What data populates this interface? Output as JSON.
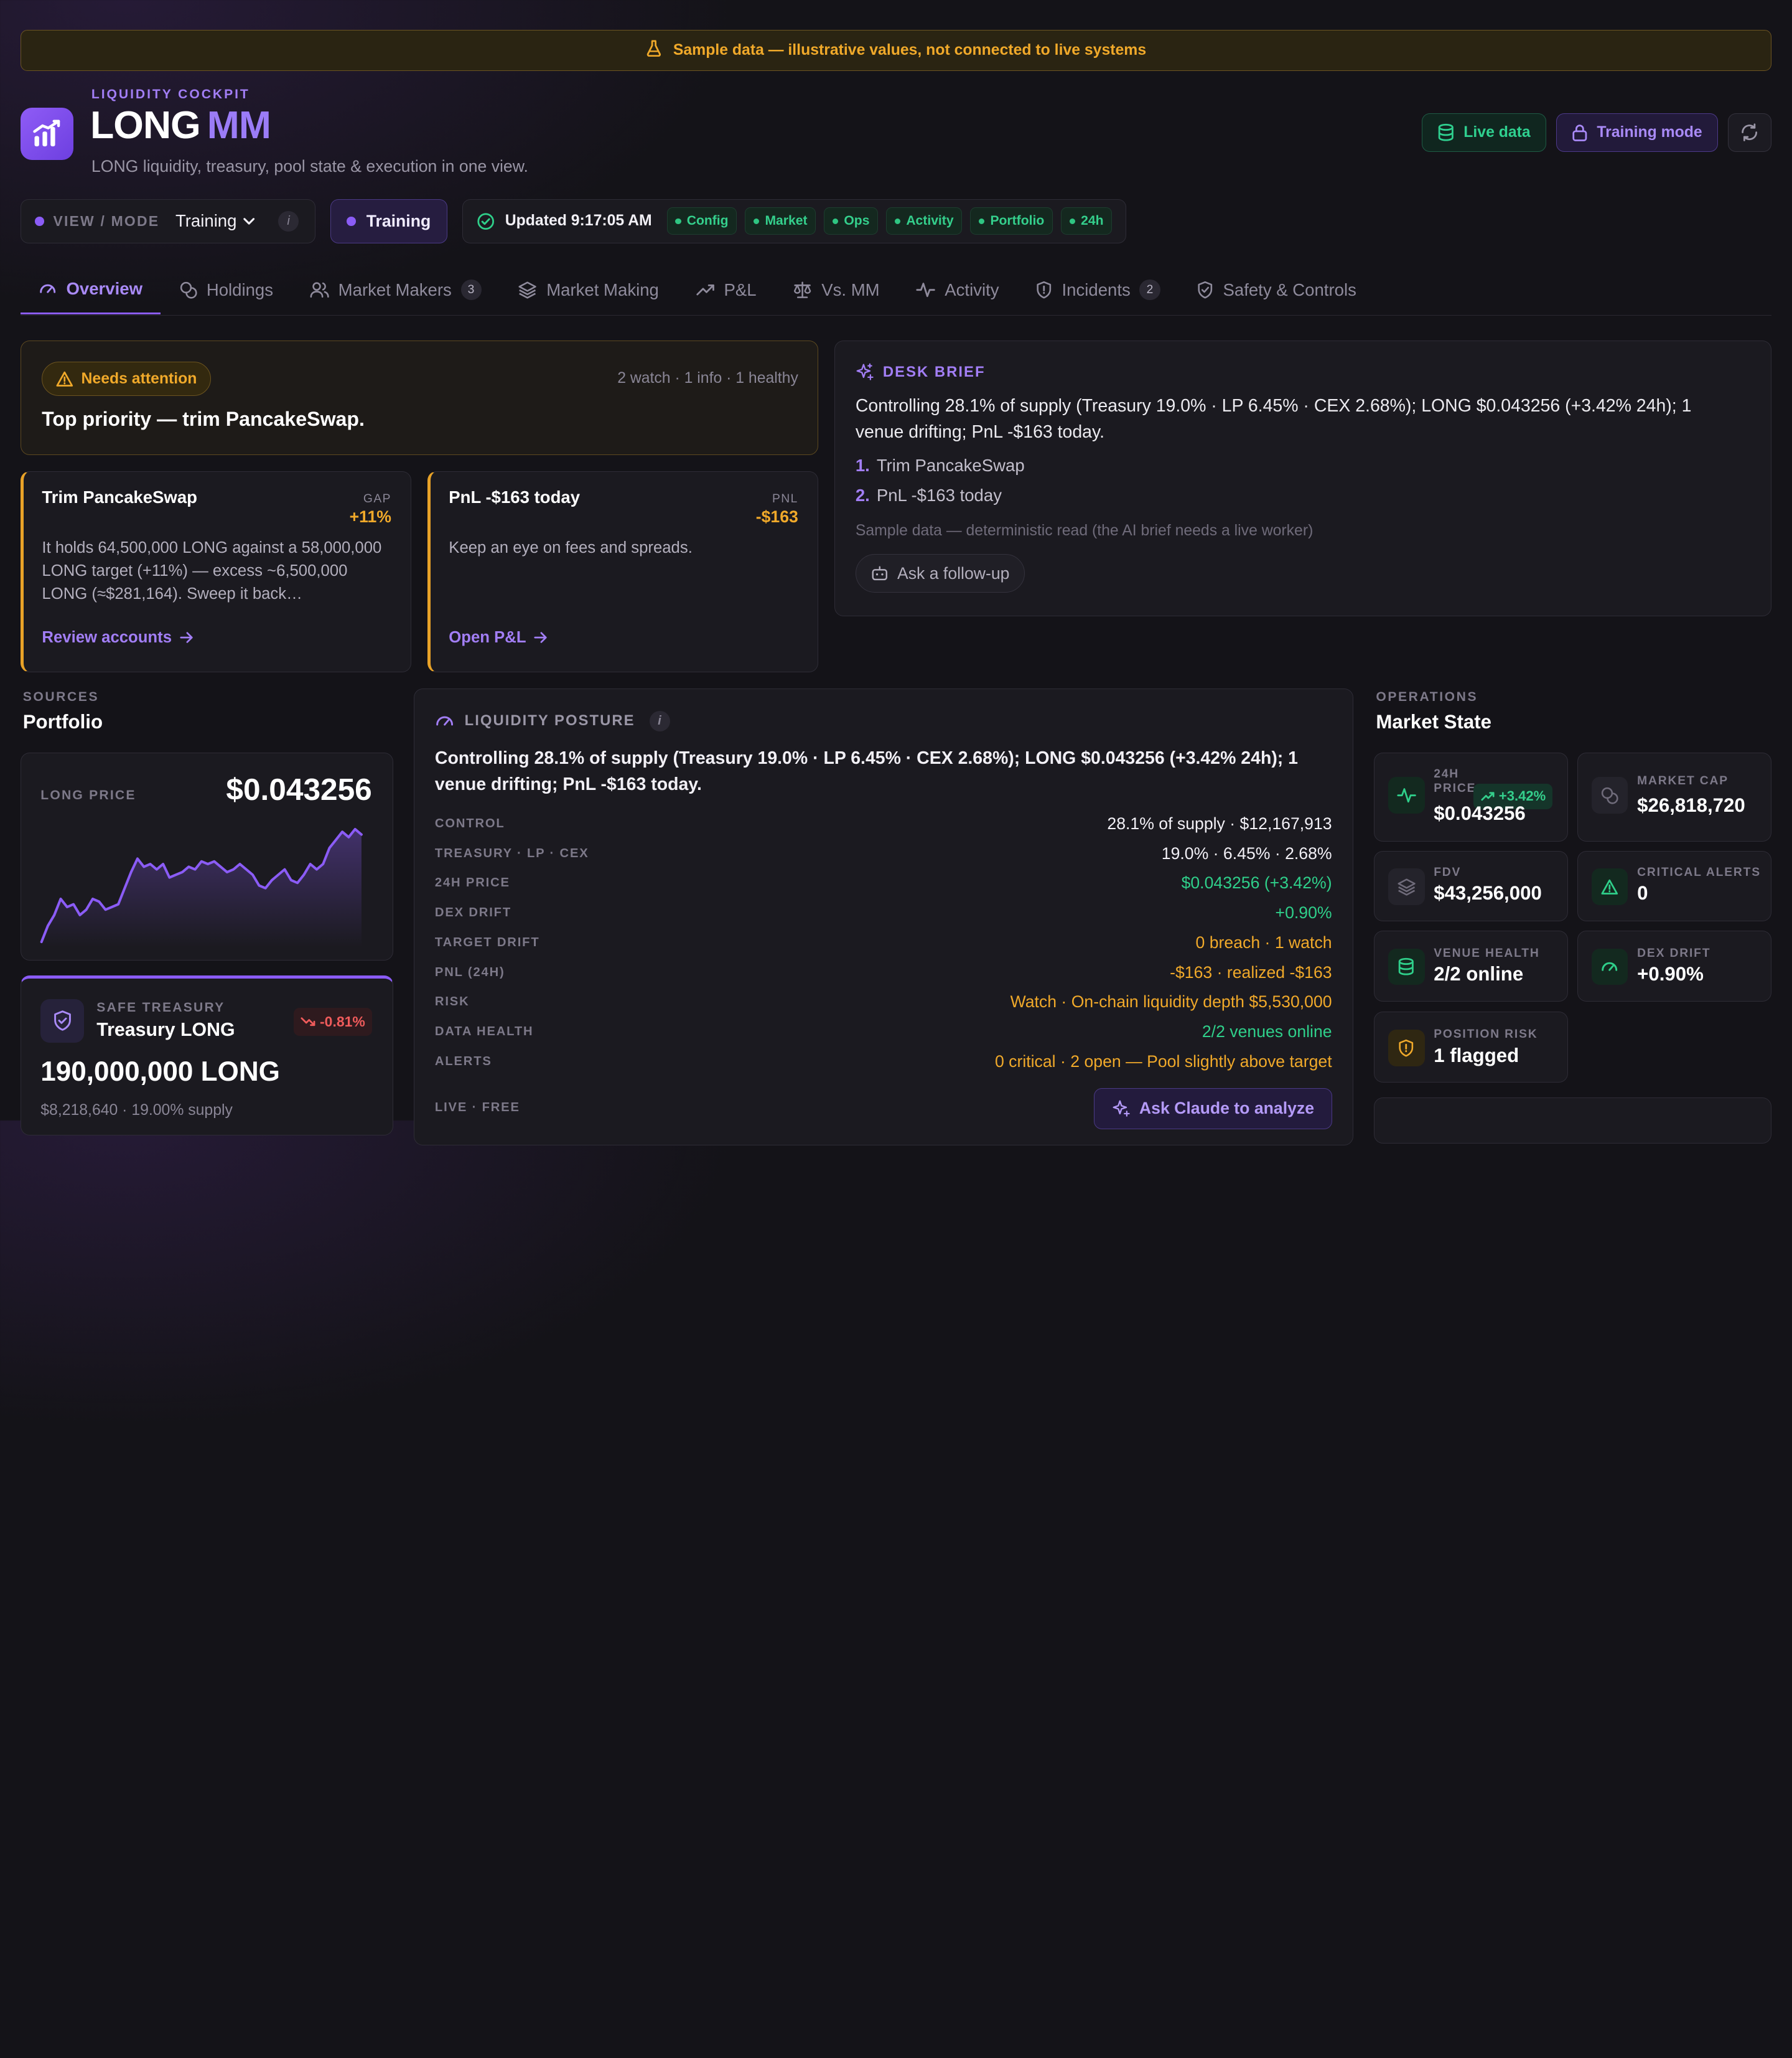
{
  "banner": {
    "text": "Sample data — illustrative values, not connected to live systems"
  },
  "header": {
    "eyebrow": "LIQUIDITY COCKPIT",
    "title_a": "LONG",
    "title_b": "MM",
    "subtitle": "LONG liquidity, treasury, pool state & execution in one view.",
    "live_label": "Live data",
    "training_label": "Training mode"
  },
  "modebar": {
    "view_label": "VIEW / MODE",
    "view_value": "Training",
    "training_chip": "Training",
    "updated": "Updated 9:17:05 AM",
    "tags": [
      "Config",
      "Market",
      "Ops",
      "Activity",
      "Portfolio",
      "24h"
    ]
  },
  "tabs": [
    {
      "label": "Overview"
    },
    {
      "label": "Holdings"
    },
    {
      "label": "Market Makers",
      "count": "3"
    },
    {
      "label": "Market Making"
    },
    {
      "label": "P&L"
    },
    {
      "label": "Vs. MM"
    },
    {
      "label": "Activity"
    },
    {
      "label": "Incidents",
      "count": "2"
    },
    {
      "label": "Safety & Controls"
    }
  ],
  "attention": {
    "badge": "Needs attention",
    "meta": "2 watch · 1 info · 1 healthy",
    "title": "Top priority — trim PancakeSwap."
  },
  "action_cards": [
    {
      "title": "Trim PancakeSwap",
      "kpi_label": "GAP",
      "kpi_value": "+11%",
      "body": "It holds 64,500,000 LONG against a 58,000,000 LONG target (+11%) — excess ~6,500,000 LONG (≈$281,164). Sweep it back…",
      "link": "Review accounts"
    },
    {
      "title": "PnL -$163 today",
      "kpi_label": "PNL",
      "kpi_value": "-$163",
      "body": "Keep an eye on fees and spreads.",
      "link": "Open P&L"
    }
  ],
  "brief": {
    "label": "DESK BRIEF",
    "text": "Controlling 28.1% of supply (Treasury 19.0% · LP 6.45% · CEX 2.68%); LONG $0.043256 (+3.42% 24h); 1 venue drifting; PnL -$163 today.",
    "items": [
      {
        "n": "1.",
        "text": "Trim PancakeSwap"
      },
      {
        "n": "2.",
        "text": "PnL -$163 today"
      }
    ],
    "note": "Sample data — deterministic read (the AI brief needs a live worker)",
    "ask": "Ask a follow-up"
  },
  "sources": {
    "eyebrow": "SOURCES",
    "title": "Portfolio",
    "price_label": "LONG PRICE",
    "price_value": "$0.043256",
    "treasury_label": "SAFE TREASURY",
    "treasury_name": "Treasury LONG",
    "treasury_change": "-0.81%",
    "treasury_amount": "190,000,000 LONG",
    "treasury_sub": "$8,218,640 · 19.00% supply"
  },
  "chart_data": {
    "type": "area",
    "title": "",
    "series": [
      {
        "values": [
          0.03,
          0.033,
          0.035,
          0.038,
          0.0365,
          0.037,
          0.035,
          0.036,
          0.038,
          0.0375,
          0.036,
          0.0365,
          0.037,
          0.04,
          0.043,
          0.0455,
          0.044,
          0.0445,
          0.0435,
          0.0445,
          0.042,
          0.0425,
          0.043,
          0.044,
          0.0435,
          0.045,
          0.0445,
          0.045,
          0.044,
          0.043,
          0.0435,
          0.0445,
          0.0435,
          0.0425,
          0.0405,
          0.04,
          0.0415,
          0.0425,
          0.0435,
          0.0415,
          0.041,
          0.0425,
          0.0445,
          0.0435,
          0.0445,
          0.0475,
          0.049,
          0.0505,
          0.0495,
          0.051,
          0.05
        ]
      }
    ],
    "ylim": [
      0.029,
      0.052
    ],
    "color": "#8b5cf6"
  },
  "posture": {
    "label": "LIQUIDITY POSTURE",
    "text": "Controlling 28.1% of supply (Treasury 19.0% · LP 6.45% · CEX 2.68%); LONG $0.043256 (+3.42% 24h); 1 venue drifting; PnL -$163 today.",
    "rows": [
      {
        "k": "CONTROL",
        "v": "28.1% of supply · $12,167,913",
        "tone": ""
      },
      {
        "k": "TREASURY · LP · CEX",
        "v": "19.0% · 6.45% · 2.68%",
        "tone": ""
      },
      {
        "k": "24H PRICE",
        "v": "$0.043256 (+3.42%)",
        "tone": "green"
      },
      {
        "k": "DEX DRIFT",
        "v": "+0.90%",
        "tone": "green"
      },
      {
        "k": "TARGET DRIFT",
        "v": "0 breach · 1 watch",
        "tone": "amber"
      },
      {
        "k": "PNL (24H)",
        "v": "-$163 · realized -$163",
        "tone": "amber"
      },
      {
        "k": "RISK",
        "v": "Watch · On-chain liquidity depth $5,530,000",
        "tone": "amber"
      },
      {
        "k": "DATA HEALTH",
        "v": "2/2 venues online",
        "tone": "green"
      },
      {
        "k": "ALERTS",
        "v": "0 critical · 2 open — Pool slightly above target",
        "tone": "amber"
      }
    ],
    "live": "LIVE · FREE",
    "claude": "Ask Claude to analyze"
  },
  "market": {
    "eyebrow": "OPERATIONS",
    "title": "Market State",
    "price_label": "24H PRICE",
    "price_value": "$0.043256",
    "price_change": "+3.42%",
    "mcap_label": "MARKET CAP",
    "mcap_value": "$26,818,720",
    "fdv_label": "FDV",
    "fdv_value": "$43,256,000",
    "crit_label": "CRITICAL ALERTS",
    "crit_value": "0",
    "venue_label": "VENUE HEALTH",
    "venue_value": "2/2 online",
    "drift_label": "DEX DRIFT",
    "drift_value": "+0.90%",
    "risk_label": "POSITION RISK",
    "risk_value": "1 flagged"
  }
}
